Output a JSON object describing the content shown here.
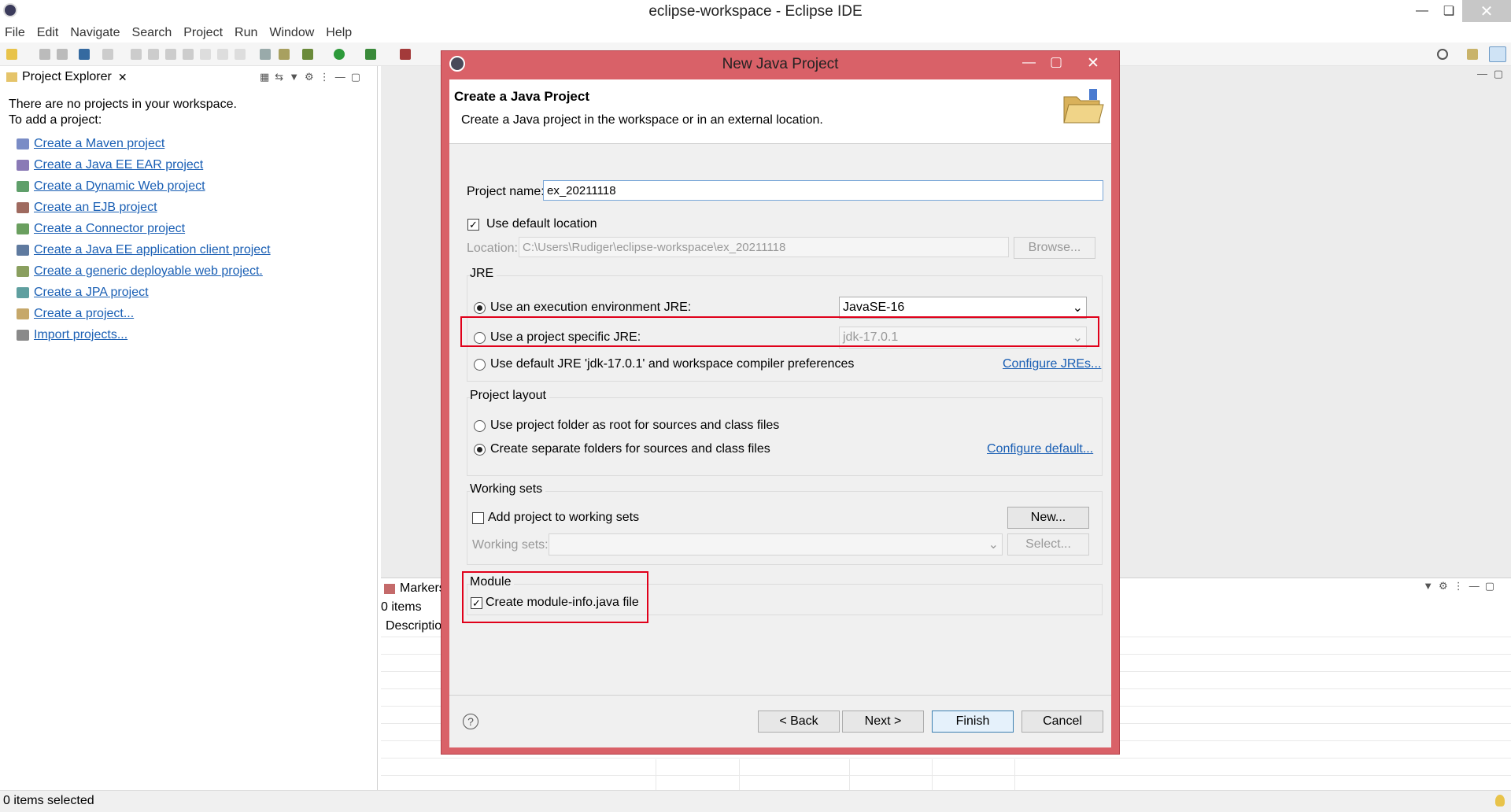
{
  "window": {
    "title": "eclipse-workspace - Eclipse IDE"
  },
  "menu": [
    "File",
    "Edit",
    "Navigate",
    "Search",
    "Project",
    "Run",
    "Window",
    "Help"
  ],
  "explorer": {
    "tab": "Project Explorer",
    "msg1": "There are no projects in your workspace.",
    "msg2": "To add a project:",
    "links": [
      "Create a Maven project",
      "Create a Java EE EAR project",
      "Create a Dynamic Web project",
      "Create an EJB project",
      "Create a Connector project",
      "Create a Java EE application client project",
      "Create a generic deployable web project.",
      "Create a JPA project",
      "Create a project...",
      "Import projects..."
    ]
  },
  "markers": {
    "tab": "Markers",
    "count": "0 items",
    "col_description": "Descriptio"
  },
  "status": {
    "left": "0 items selected"
  },
  "dialog": {
    "title": "New Java Project",
    "heading": "Create a Java Project",
    "subheading": "Create a Java project in the workspace or in an external location.",
    "project_name_label": "Project name:",
    "project_name_value": "ex_20211118",
    "use_default_location": "Use default location",
    "location_label": "Location:",
    "location_value": "C:\\Users\\Rudiger\\eclipse-workspace\\ex_20211118",
    "browse": "Browse...",
    "jre_group": "JRE",
    "jre_exec_env": "Use an execution environment JRE:",
    "jre_exec_env_value": "JavaSE-16",
    "jre_project_specific": "Use a project specific JRE:",
    "jre_project_specific_value": "jdk-17.0.1",
    "jre_default": "Use default JRE 'jdk-17.0.1' and workspace compiler preferences",
    "configure_jres": "Configure JREs...",
    "layout_group": "Project layout",
    "layout_root": "Use project folder as root for sources and class files",
    "layout_separate": "Create separate folders for sources and class files",
    "configure_default": "Configure default...",
    "ws_group": "Working sets",
    "ws_add": "Add project to working sets",
    "ws_new": "New...",
    "ws_label": "Working sets:",
    "ws_select": "Select...",
    "module_group": "Module",
    "module_create": "Create module-info.java file",
    "back": "< Back",
    "next": "Next >",
    "finish": "Finish",
    "cancel": "Cancel"
  }
}
